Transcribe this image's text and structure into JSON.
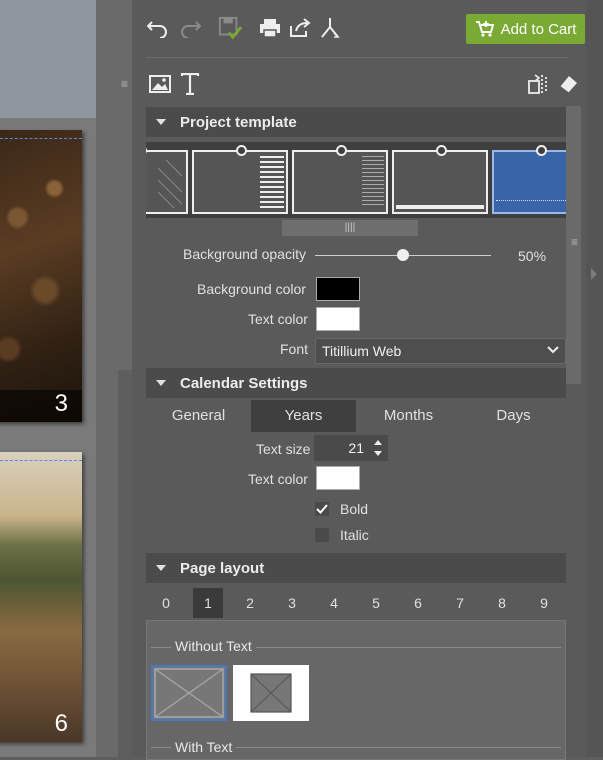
{
  "canvas": {
    "pages": [
      {
        "number": "3"
      },
      {
        "number": "6"
      }
    ]
  },
  "toolbar": {
    "icons": [
      "undo-icon",
      "redo-icon",
      "save-icon",
      "print-icon",
      "share-icon",
      "order-icon"
    ],
    "add_to_cart_label": "Add to Cart",
    "add_to_cart_color": "#7aa934"
  },
  "insert": {
    "icons": [
      "image-icon",
      "text-icon",
      "layers-icon",
      "eraser-icon"
    ]
  },
  "project_template": {
    "title": "Project template",
    "background_opacity_label": "Background opacity",
    "background_opacity_value": "50%",
    "background_opacity_fraction": 0.5,
    "background_color_label": "Background color",
    "background_color": "#000000",
    "text_color_label": "Text color",
    "text_color": "#ffffff",
    "font_label": "Font",
    "font_value": "Titillium Web"
  },
  "calendar_settings": {
    "title": "Calendar Settings",
    "tabs": [
      "General",
      "Years",
      "Months",
      "Days"
    ],
    "active_tab": "Years",
    "text_size_label": "Text size",
    "text_size_value": "21",
    "text_color_label": "Text color",
    "text_color": "#ffffff",
    "bold_label": "Bold",
    "bold_checked": true,
    "italic_label": "Italic",
    "italic_checked": false
  },
  "page_layout": {
    "title": "Page layout",
    "numbers": [
      "0",
      "1",
      "2",
      "3",
      "4",
      "5",
      "6",
      "7",
      "8",
      "9"
    ],
    "active_number": "1",
    "group_without_text": "Without Text",
    "group_with_text": "With Text"
  }
}
